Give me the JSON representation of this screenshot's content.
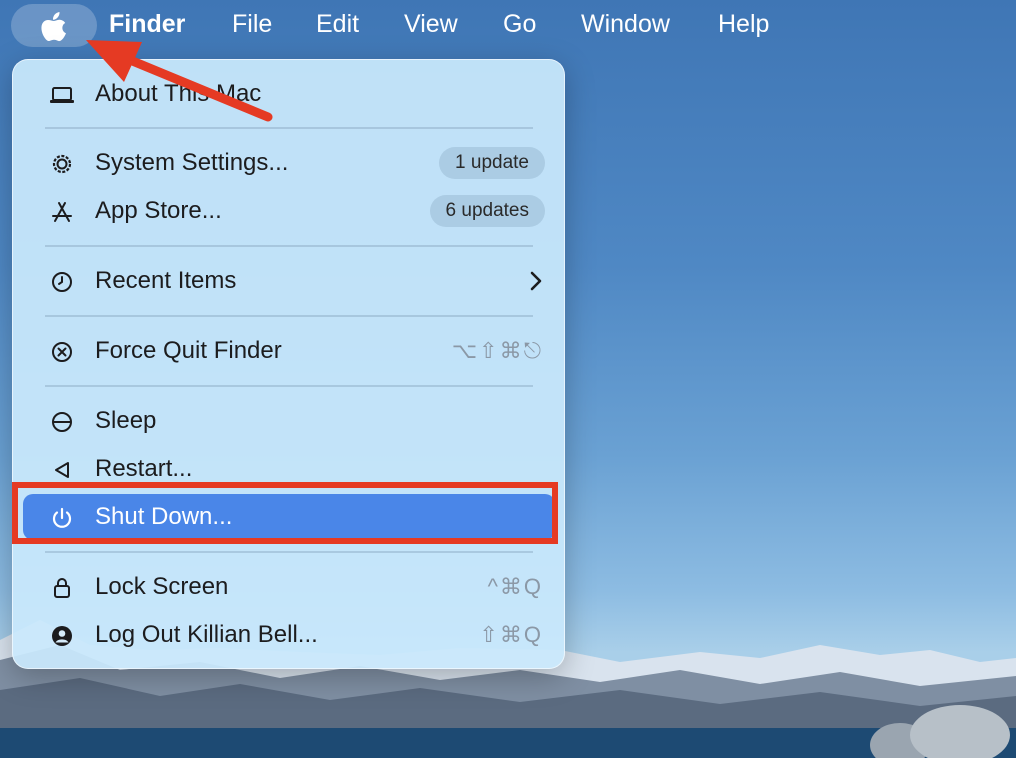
{
  "menubar": {
    "apple_icon": "apple-logo-icon",
    "items": [
      "Finder",
      "File",
      "Edit",
      "View",
      "Go",
      "Window",
      "Help"
    ]
  },
  "apple_menu": {
    "about": {
      "label": "About This Mac",
      "icon": "laptop-icon"
    },
    "system_settings": {
      "label": "System Settings...",
      "badge": "1 update",
      "icon": "gear-icon"
    },
    "app_store": {
      "label": "App Store...",
      "badge": "6 updates",
      "icon": "app-store-icon"
    },
    "recent_items": {
      "label": "Recent Items",
      "icon": "clock-icon",
      "submenu_icon": "chevron-right-icon"
    },
    "force_quit": {
      "label": "Force Quit Finder",
      "shortcut": "⌥⇧⌘⎋",
      "icon": "x-circle-icon"
    },
    "sleep": {
      "label": "Sleep",
      "icon": "sleep-icon"
    },
    "restart": {
      "label": "Restart...",
      "icon": "restart-icon"
    },
    "shut_down": {
      "label": "Shut Down...",
      "icon": "power-icon",
      "selected": true
    },
    "lock_screen": {
      "label": "Lock Screen",
      "shortcut": "^⌘Q",
      "icon": "lock-icon"
    },
    "log_out": {
      "label": "Log Out Killian Bell...",
      "shortcut": "⇧⌘Q",
      "icon": "user-circle-icon"
    }
  },
  "colors": {
    "selection": "#4a86e8",
    "annotation": "#e53a23",
    "menu_background": "#c9e8fc"
  }
}
